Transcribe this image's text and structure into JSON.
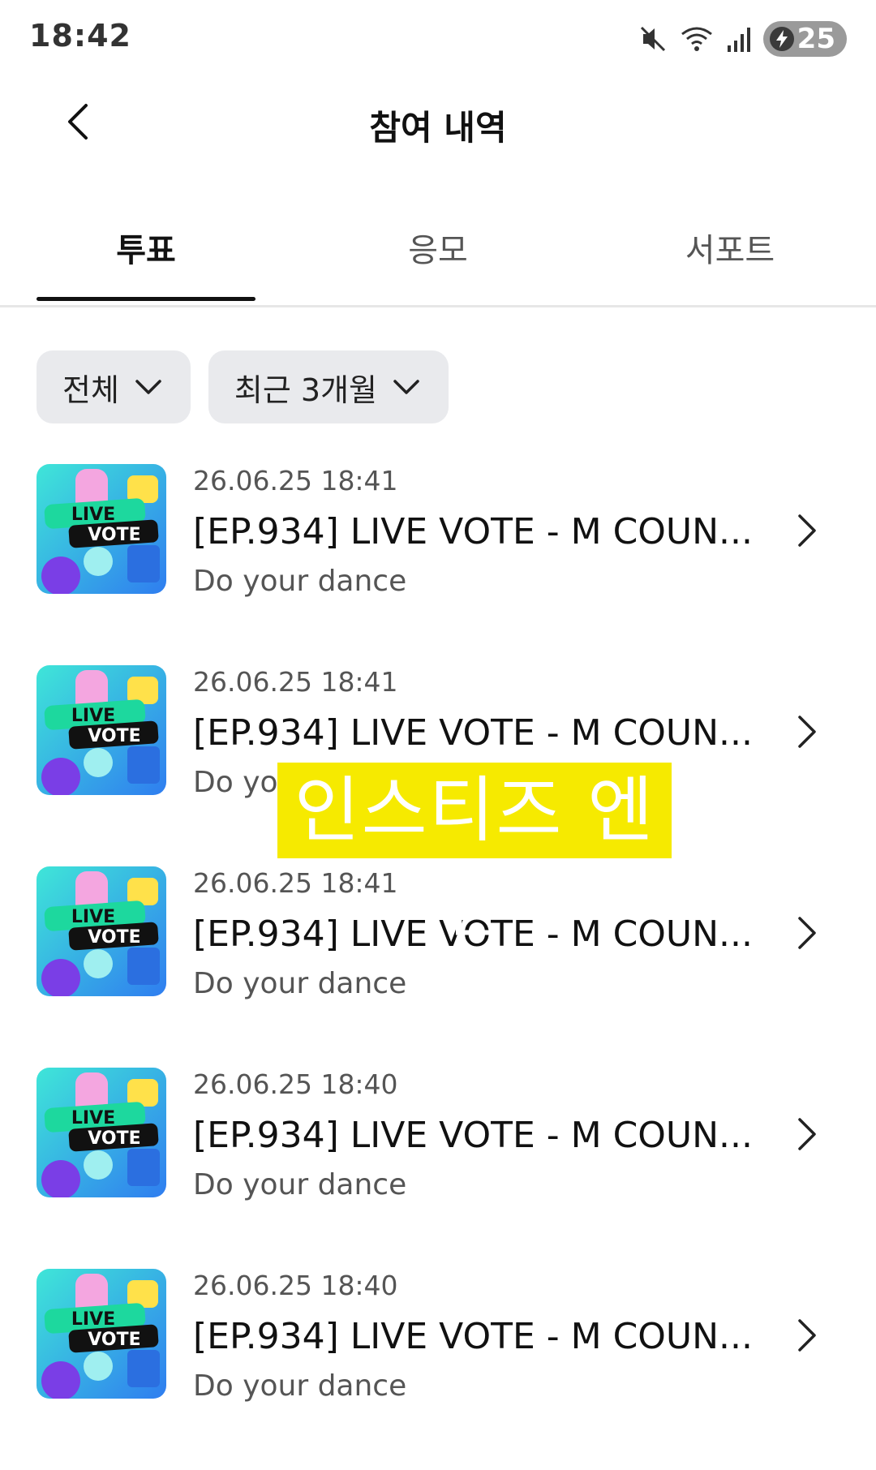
{
  "status_bar": {
    "time": "18:42",
    "battery_level": "25",
    "icons": [
      "mute-icon",
      "wifi-icon",
      "signal-icon",
      "battery-icon"
    ]
  },
  "header": {
    "title": "참여 내역",
    "back_icon": "chevron-left-icon"
  },
  "tabs": [
    {
      "label": "투표",
      "active": true
    },
    {
      "label": "응모",
      "active": false
    },
    {
      "label": "서포트",
      "active": false
    }
  ],
  "filters": [
    {
      "label": "전체",
      "icon": "chevron-down-icon"
    },
    {
      "label": "최근 3개월",
      "icon": "chevron-down-icon"
    }
  ],
  "items": [
    {
      "date": "26.06.25 18:41",
      "title": "[EP.934] LIVE VOTE - M COUN...",
      "subtitle": "Do your dance",
      "thumb_line1": "LIVE",
      "thumb_line2": "VOTE"
    },
    {
      "date": "26.06.25 18:41",
      "title": "[EP.934] LIVE VOTE - M COUN...",
      "subtitle": "Do your dance",
      "thumb_line1": "LIVE",
      "thumb_line2": "VOTE"
    },
    {
      "date": "26.06.25 18:41",
      "title": "[EP.934] LIVE VOTE - M COUN...",
      "subtitle": "Do your dance",
      "thumb_line1": "LIVE",
      "thumb_line2": "VOTE"
    },
    {
      "date": "26.06.25 18:40",
      "title": "[EP.934] LIVE VOTE - M COUN...",
      "subtitle": "Do your dance",
      "thumb_line1": "LIVE",
      "thumb_line2": "VOTE"
    },
    {
      "date": "26.06.25 18:40",
      "title": "[EP.934] LIVE VOTE - M COUN...",
      "subtitle": "Do your dance",
      "thumb_line1": "LIVE",
      "thumb_line2": "VOTE"
    }
  ],
  "overlay_caption": "인스티즈 엔진",
  "colors": {
    "overlay_bg": "#f6ea00",
    "tab_indicator": "#111111",
    "chip_bg": "#e9eaed"
  }
}
